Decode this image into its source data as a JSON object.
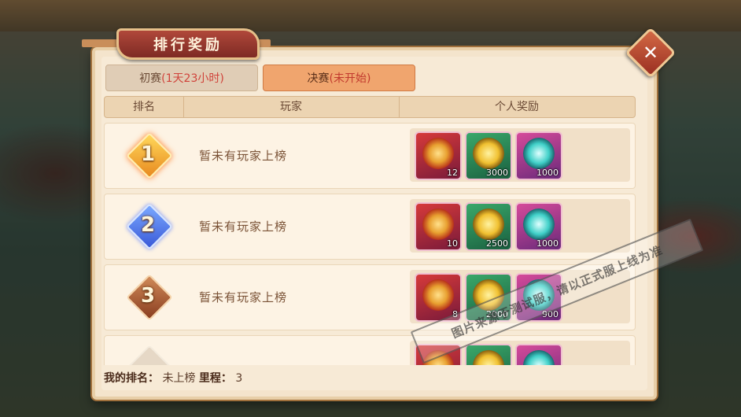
{
  "title": "排行奖励",
  "close_icon": "✕",
  "tabs": [
    {
      "label": "初赛",
      "status": "(1天23小时)"
    },
    {
      "label": "决赛",
      "status": "(未开始)"
    }
  ],
  "columns": [
    "排名",
    "玩家",
    "个人奖励"
  ],
  "rows": [
    {
      "rank": "1",
      "player": "暂未有玩家上榜",
      "rewards": [
        {
          "icon": "red-medal-icon",
          "count": "12"
        },
        {
          "icon": "anchor-coin-icon",
          "count": "3000"
        },
        {
          "icon": "crystal-orb-icon",
          "count": "1000"
        }
      ]
    },
    {
      "rank": "2",
      "player": "暂未有玩家上榜",
      "rewards": [
        {
          "icon": "red-medal-icon",
          "count": "10"
        },
        {
          "icon": "anchor-coin-icon",
          "count": "2500"
        },
        {
          "icon": "crystal-orb-icon",
          "count": "1000"
        }
      ]
    },
    {
      "rank": "3",
      "player": "暂未有玩家上榜",
      "rewards": [
        {
          "icon": "red-medal-icon",
          "count": "8"
        },
        {
          "icon": "anchor-coin-icon",
          "count": "2000"
        },
        {
          "icon": "crystal-orb-icon",
          "count": "900"
        }
      ]
    },
    {
      "rank": "",
      "player": "",
      "rewards": [
        {
          "icon": "red-medal-icon",
          "count": ""
        },
        {
          "icon": "anchor-coin-icon",
          "count": ""
        },
        {
          "icon": "crystal-orb-icon",
          "count": ""
        }
      ]
    }
  ],
  "footer": {
    "my_rank_label": "我的排名：",
    "my_rank_value": "未上榜",
    "mileage_label": "里程：",
    "mileage_value": "3"
  },
  "watermark": "图片来源于测试服，请以正式服上线为准"
}
